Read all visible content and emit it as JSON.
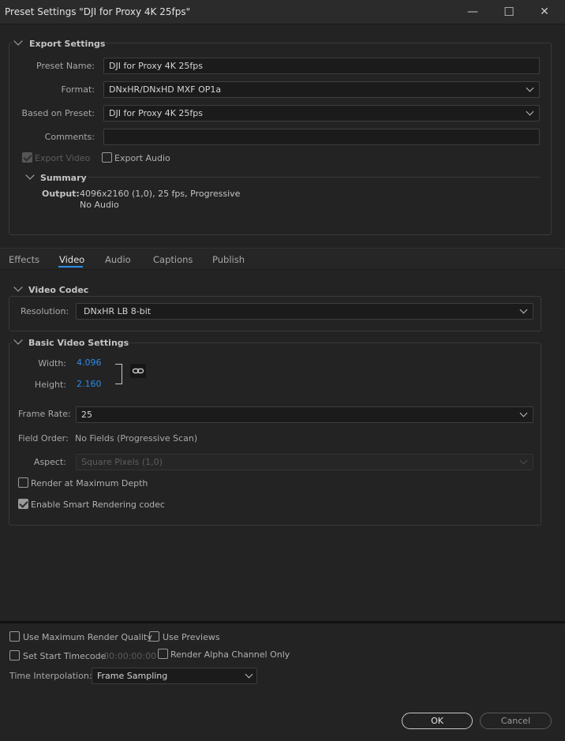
{
  "window": {
    "title": "Preset Settings \"DJI for Proxy 4K 25fps\"",
    "minimize": "—",
    "maximize": "☐",
    "close": "✕"
  },
  "export_settings": {
    "section_title": "Export Settings",
    "preset_name_label": "Preset Name:",
    "preset_name_value": "DJI for Proxy 4K 25fps",
    "format_label": "Format:",
    "format_value": "DNxHR/DNxHD MXF OP1a",
    "based_on_label": "Based on Preset:",
    "based_on_value": "DJI for Proxy 4K 25fps",
    "comments_label": "Comments:",
    "comments_value": "",
    "export_video_label": "Export Video",
    "export_audio_label": "Export Audio",
    "summary_title": "Summary",
    "output_label": "Output:",
    "output_line1": "4096x2160 (1,0), 25 fps, Progressive",
    "output_line2": "No Audio"
  },
  "tabs": [
    {
      "label": "Effects",
      "active": false
    },
    {
      "label": "Video",
      "active": true
    },
    {
      "label": "Audio",
      "active": false
    },
    {
      "label": "Captions",
      "active": false
    },
    {
      "label": "Publish",
      "active": false
    }
  ],
  "video_codec": {
    "section_title": "Video Codec",
    "resolution_label": "Resolution:",
    "resolution_value": "DNxHR LB 8-bit"
  },
  "basic_video": {
    "section_title": "Basic Video Settings",
    "width_label": "Width:",
    "width_value": "4.096",
    "height_label": "Height:",
    "height_value": "2.160",
    "frame_rate_label": "Frame Rate:",
    "frame_rate_value": "25",
    "field_order_label": "Field Order:",
    "field_order_value": "No Fields (Progressive Scan)",
    "aspect_label": "Aspect:",
    "aspect_value": "Square Pixels (1,0)",
    "render_max_depth_label": "Render at Maximum Depth",
    "smart_rendering_label": "Enable Smart Rendering codec"
  },
  "bottom": {
    "max_render_quality_label": "Use Maximum Render Quality",
    "use_previews_label": "Use Previews",
    "set_start_timecode_label": "Set Start Timecode",
    "timecode_value": "00:00:00:00",
    "render_alpha_label": "Render Alpha Channel Only",
    "time_interp_label": "Time Interpolation:",
    "time_interp_value": "Frame Sampling"
  },
  "buttons": {
    "ok": "OK",
    "cancel": "Cancel"
  },
  "colors": {
    "accent": "#2d8ceb",
    "background": "#232323"
  }
}
